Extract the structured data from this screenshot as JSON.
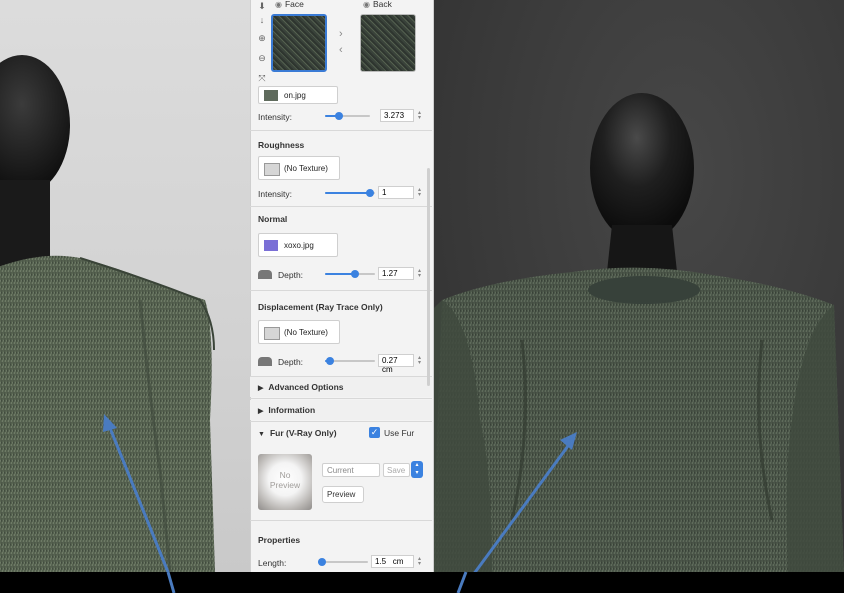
{
  "swatch_tabs": {
    "face_label": "Face",
    "back_label": "Back"
  },
  "texture_top": {
    "file": "on.jpg"
  },
  "intensity_1": {
    "label": "Intensity:",
    "value": "3.273",
    "fraction": 0.3
  },
  "roughness": {
    "title": "Roughness",
    "texture": "(No Texture)",
    "intensity_label": "Intensity:",
    "value": "1",
    "fraction": 0.9
  },
  "normal": {
    "title": "Normal",
    "texture": "xoxo.jpg",
    "depth_label": "Depth:",
    "value": "1.27",
    "fraction": 0.6
  },
  "displacement": {
    "title": "Displacement (Ray Trace Only)",
    "texture": "(No Texture)",
    "depth_label": "Depth:",
    "value": "0.27",
    "unit": "cm",
    "fraction": 0.1
  },
  "advanced": {
    "label": "Advanced Options"
  },
  "information": {
    "label": "Information"
  },
  "fur": {
    "label": "Fur (V-Ray Only)",
    "use_fur_label": "Use Fur",
    "use_fur": true,
    "preview_text": "No\nPreview",
    "current_label": "Current",
    "save_label": "Save",
    "preview_button": "Preview"
  },
  "properties": {
    "title": "Properties",
    "length_label": "Length:",
    "length_value": "1.5",
    "length_unit": "cm",
    "fraction": 0.08
  },
  "colors": {
    "accent": "#3b82e0",
    "arrow": "#4a7bbf",
    "fur_dark": "#3e4a40"
  }
}
